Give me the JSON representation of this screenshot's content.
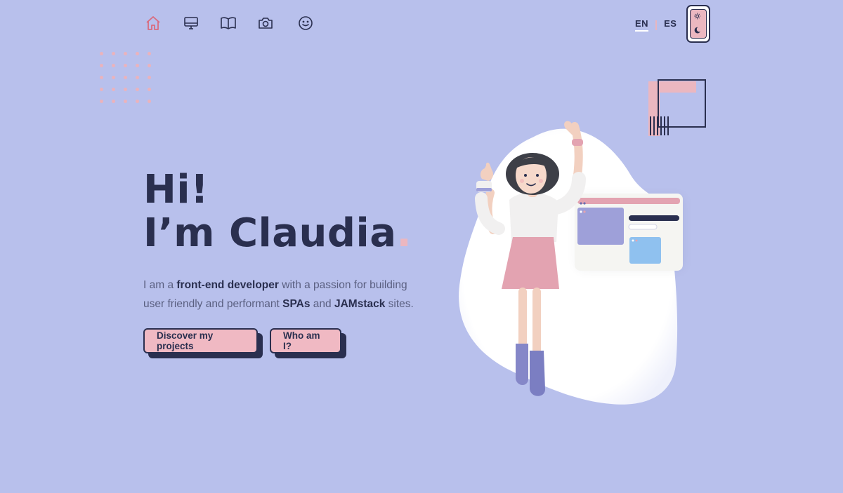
{
  "nav": {
    "items": [
      {
        "icon": "home-icon",
        "label": "Home"
      },
      {
        "icon": "monitor-icon",
        "label": "Projects"
      },
      {
        "icon": "book-icon",
        "label": "Blog"
      },
      {
        "icon": "camera-icon",
        "label": "Photos"
      },
      {
        "icon": "smile-icon",
        "label": "About"
      }
    ],
    "active_color": "#d96b7e"
  },
  "lang": {
    "en": "EN",
    "es": "ES",
    "selected": "EN"
  },
  "hero": {
    "line1": "Hi!",
    "line2": "I’m Claudia",
    "dot": ".",
    "intro_1": "I am a ",
    "role": "front-end developer",
    "intro_2": " with a passion for building user friendly and performant ",
    "spas": "SPAs",
    "and": " and ",
    "jam": "JAMstack",
    "sites": " sites."
  },
  "buttons": {
    "projects": "Discover my projects",
    "who": "Who am I?"
  },
  "colors": {
    "background": "#b8c0ec",
    "accent": "#ebb7c0",
    "dark": "#2a2f4f"
  }
}
